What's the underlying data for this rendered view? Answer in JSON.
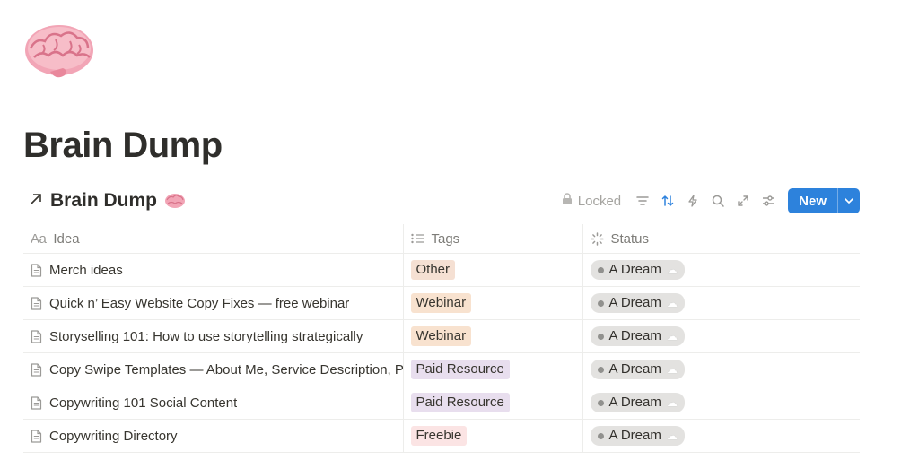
{
  "page": {
    "icon": "brain-emoji",
    "title": "Brain Dump"
  },
  "database": {
    "title_prefix_icon": "arrow-northeast-icon",
    "title": "Brain Dump",
    "title_icon": "brain-emoji",
    "toolbar": {
      "locked_label": "Locked",
      "icons": [
        "lock-icon",
        "filter-icon",
        "sort-icon",
        "automation-bolt-icon",
        "search-icon",
        "expand-icon",
        "settings-sliders-icon"
      ],
      "new_label": "New"
    },
    "columns": [
      {
        "label": "Idea",
        "icon": "title-aa-icon"
      },
      {
        "label": "Tags",
        "icon": "list-icon"
      },
      {
        "label": "Status",
        "icon": "status-spinner-icon"
      }
    ],
    "rows": [
      {
        "idea": "Merch ideas",
        "tag": "Other",
        "status": "A Dream"
      },
      {
        "idea": "Quick n’ Easy Website Copy Fixes — free webinar",
        "tag": "Webinar",
        "status": "A Dream"
      },
      {
        "idea": "Storyselling 101: How to use storytelling strategically",
        "tag": "Webinar",
        "status": "A Dream"
      },
      {
        "idea": "Copy Swipe Templates — About Me, Service Description, Pr",
        "tag": "Paid Resource",
        "status": "A Dream"
      },
      {
        "idea": "Copywriting 101 Social Content",
        "tag": "Paid Resource",
        "status": "A Dream"
      },
      {
        "idea": "Copywriting Directory",
        "tag": "Freebie",
        "status": "A Dream"
      }
    ]
  },
  "tag_colors": {
    "Other": {
      "bg": "#f5e0d3",
      "fg": "#37352f"
    },
    "Webinar": {
      "bg": "#f8e2cf",
      "fg": "#37352f"
    },
    "Paid Resource": {
      "bg": "#e8deee",
      "fg": "#37352f"
    },
    "Freebie": {
      "bg": "#fbe4e4",
      "fg": "#37352f"
    }
  },
  "status_emoji": "cloud-icon",
  "accent_color": "#2d82dc"
}
